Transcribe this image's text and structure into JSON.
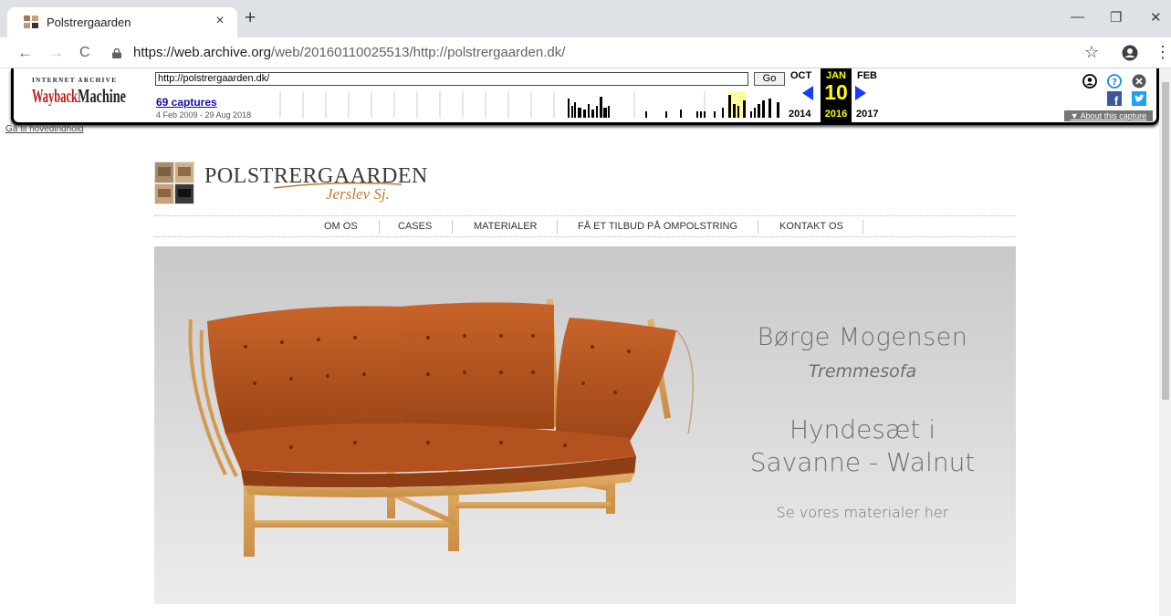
{
  "browser": {
    "tab_title": "Polstrergaarden",
    "tab_close": "×",
    "new_tab": "+",
    "url_host": "https://web.archive.org",
    "url_path": "/web/20160110025513/http://polstrergaarden.dk/",
    "window_controls": {
      "minimize": "—",
      "restore": "❐",
      "close": "✕"
    },
    "nav": {
      "back": "←",
      "forward": "→",
      "reload": "C"
    },
    "icons": [
      "favicon-icon",
      "lock-icon",
      "star-icon",
      "profile-icon",
      "menu-kebab-icon"
    ]
  },
  "wayback": {
    "logo_top": "INTERNET ARCHIVE",
    "logo": "WaybackMachine",
    "url_value": "http://polstrergaarden.dk/",
    "go_label": "Go",
    "captures_link": "69 captures",
    "capture_range": "4 Feb 2009 - 29 Aug 2018",
    "prev_month": "OCT",
    "cur_month": "JAN",
    "next_month": "FEB",
    "prev_year": "2014",
    "cur_day": "10",
    "cur_year": "2016",
    "next_year": "2017",
    "about_label": "▼ About this capture",
    "icons": [
      "user-icon",
      "help-icon",
      "close-icon",
      "facebook-icon",
      "twitter-icon"
    ],
    "sparkline_heights": [
      0,
      0,
      0,
      0,
      0,
      0,
      0,
      0,
      0,
      0,
      0,
      0,
      0,
      0,
      0,
      0,
      0,
      0,
      0,
      0,
      0,
      0,
      0,
      0,
      0,
      0,
      0,
      0,
      0,
      0,
      0,
      0,
      0,
      0,
      0,
      0,
      0,
      0,
      0,
      0,
      0,
      0,
      0,
      0,
      0,
      0,
      0,
      0,
      0,
      0,
      0,
      0,
      0,
      0,
      0,
      0,
      0,
      0,
      0,
      0,
      0,
      0,
      0,
      0,
      0,
      0,
      0,
      0,
      0,
      0,
      0,
      0,
      0,
      0,
      0,
      0,
      0,
      0,
      0,
      0,
      0,
      0,
      0,
      0,
      0,
      0,
      0,
      0,
      0,
      0,
      0,
      0,
      0,
      0,
      0,
      0,
      0,
      0,
      0,
      0,
      0,
      0,
      0,
      0,
      0,
      0,
      0,
      0,
      0,
      0,
      0,
      0,
      0,
      0,
      0,
      0,
      0,
      0,
      0,
      0,
      0,
      0,
      0,
      0,
      0,
      0,
      0,
      0,
      0,
      0,
      0,
      0,
      0,
      0,
      0,
      0,
      0,
      0,
      0,
      0,
      0,
      0,
      0,
      0,
      0,
      0,
      0,
      0,
      0,
      0,
      0,
      0,
      0,
      0,
      0,
      0,
      0,
      0,
      0,
      0,
      0,
      0,
      0,
      0,
      0,
      0,
      0,
      0,
      0,
      0,
      0,
      0,
      0,
      0,
      0,
      0,
      0,
      0,
      0,
      0,
      0,
      0,
      0,
      0,
      0,
      0,
      0,
      0,
      0,
      0
    ]
  },
  "skip_link": "Gå til hovedindhold",
  "site": {
    "brand_name": "POLSTRERGAARDEN",
    "brand_sub": "Jerslev Sj.",
    "menu": [
      "OM OS",
      "CASES",
      "MATERIALER",
      "FÅ ET TILBUD PÅ OMPOLSTRING",
      "KONTAKT OS"
    ]
  },
  "hero": {
    "designer": "Børge Mogensen",
    "model": "Tremmesofa",
    "line1": "Hyndesæt i",
    "line2": "Savanne - Walnut",
    "link": "Se vores materialer her",
    "colors": {
      "leather": "#b8531c",
      "wood": "#d9a35a"
    }
  }
}
